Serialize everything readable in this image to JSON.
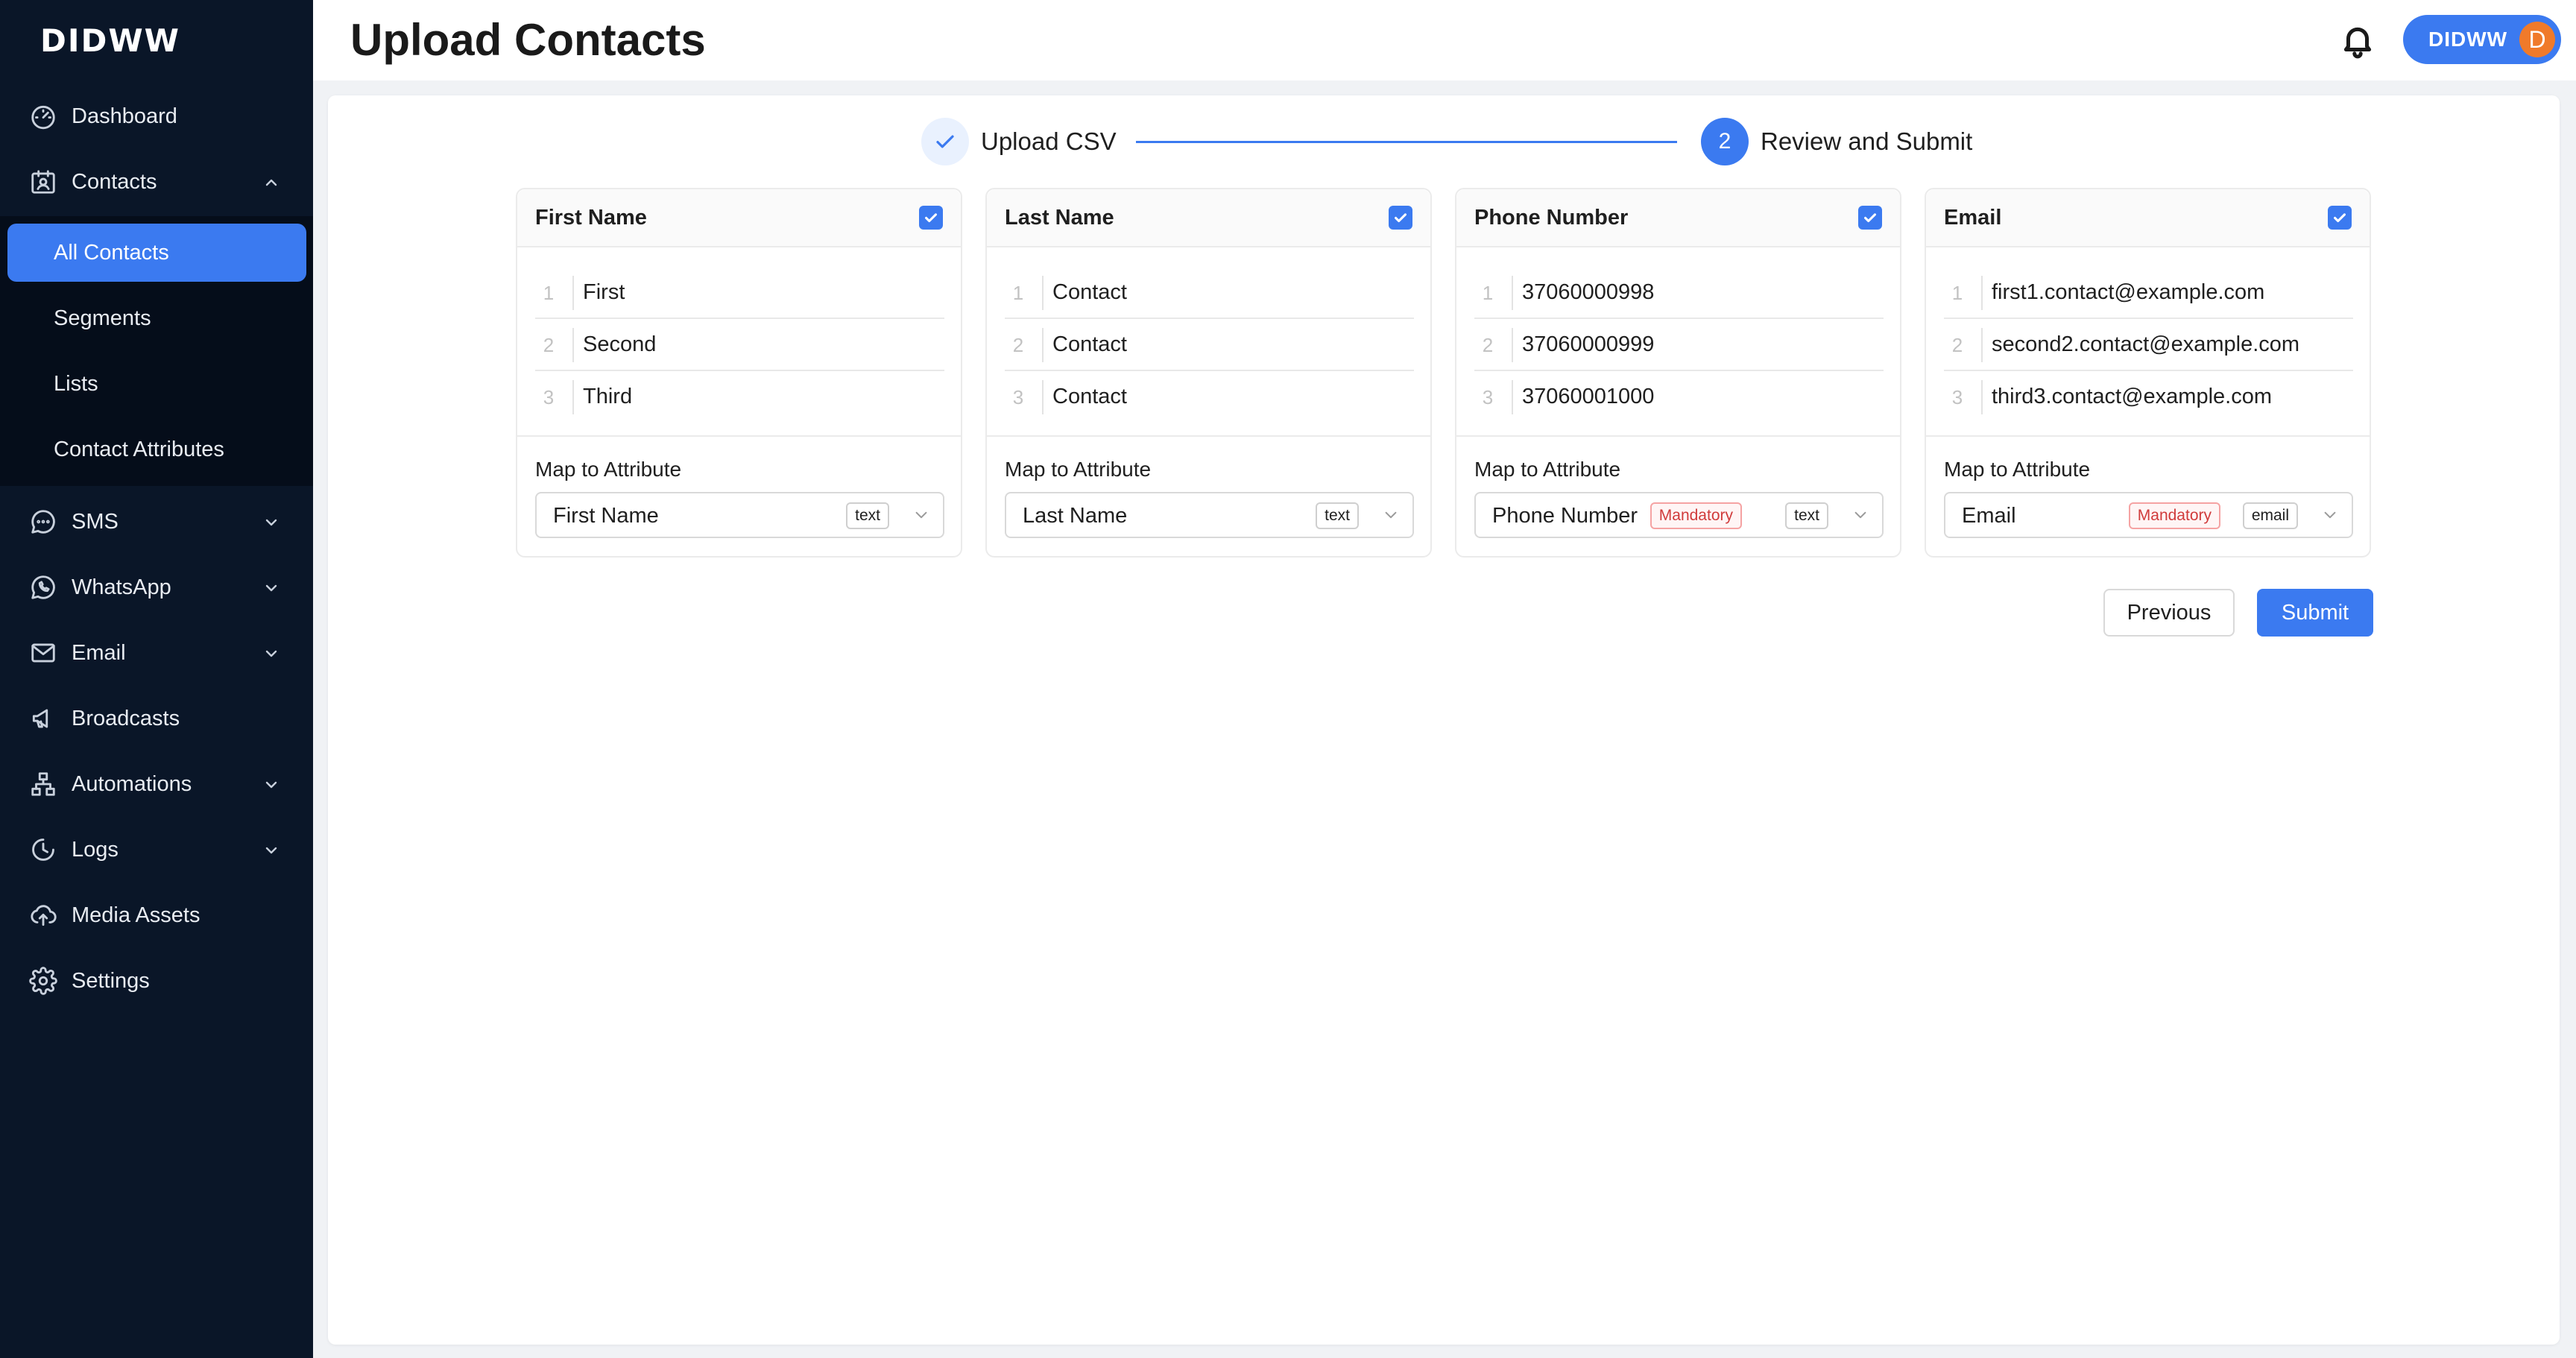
{
  "brand": {
    "logo": "DIDWW"
  },
  "header": {
    "title": "Upload Contacts",
    "user_name": "DIDWW",
    "avatar_initial": "D"
  },
  "sidebar": {
    "items": [
      {
        "label": "Dashboard",
        "icon": "dashboard-icon"
      },
      {
        "label": "Contacts",
        "icon": "contacts-icon",
        "expanded": true
      },
      {
        "label": "SMS",
        "icon": "sms-icon"
      },
      {
        "label": "WhatsApp",
        "icon": "whatsapp-icon"
      },
      {
        "label": "Email",
        "icon": "email-icon"
      },
      {
        "label": "Broadcasts",
        "icon": "megaphone-icon"
      },
      {
        "label": "Automations",
        "icon": "automations-icon"
      },
      {
        "label": "Logs",
        "icon": "clock-icon"
      },
      {
        "label": "Media Assets",
        "icon": "cloud-upload-icon"
      },
      {
        "label": "Settings",
        "icon": "gear-icon"
      }
    ],
    "contacts_sub": [
      {
        "label": "All Contacts",
        "active": true
      },
      {
        "label": "Segments"
      },
      {
        "label": "Lists"
      },
      {
        "label": "Contact Attributes"
      }
    ]
  },
  "steps": [
    {
      "label": "Upload CSV",
      "status": "done"
    },
    {
      "label": "Review and Submit",
      "number": "2",
      "status": "current"
    }
  ],
  "map_label": "Map to Attribute",
  "columns": [
    {
      "header": "First Name",
      "checked": true,
      "rows": [
        {
          "n": "1",
          "v": "First"
        },
        {
          "n": "2",
          "v": "Second"
        },
        {
          "n": "3",
          "v": "Third"
        }
      ],
      "mapped_attribute": "First Name",
      "mandatory_tag": "",
      "type_tag": "text"
    },
    {
      "header": "Last Name",
      "checked": true,
      "rows": [
        {
          "n": "1",
          "v": "Contact"
        },
        {
          "n": "2",
          "v": "Contact"
        },
        {
          "n": "3",
          "v": "Contact"
        }
      ],
      "mapped_attribute": "Last Name",
      "mandatory_tag": "",
      "type_tag": "text"
    },
    {
      "header": "Phone Number",
      "checked": true,
      "rows": [
        {
          "n": "1",
          "v": "37060000998"
        },
        {
          "n": "2",
          "v": "37060000999"
        },
        {
          "n": "3",
          "v": "37060001000"
        }
      ],
      "mapped_attribute": "Phone Number",
      "mandatory_tag": "Mandatory",
      "type_tag": "text"
    },
    {
      "header": "Email",
      "checked": true,
      "rows": [
        {
          "n": "1",
          "v": "first1.contact@example.com"
        },
        {
          "n": "2",
          "v": "second2.contact@example.com"
        },
        {
          "n": "3",
          "v": "third3.contact@example.com"
        }
      ],
      "mapped_attribute": "Email",
      "mandatory_tag": "Mandatory",
      "type_tag": "email"
    }
  ],
  "actions": {
    "previous": "Previous",
    "submit": "Submit"
  },
  "colors": {
    "accent": "#3b7af0",
    "sidebar_bg": "#0a1628",
    "avatar": "#f07a2a",
    "mandatory": "#d03b3b"
  }
}
